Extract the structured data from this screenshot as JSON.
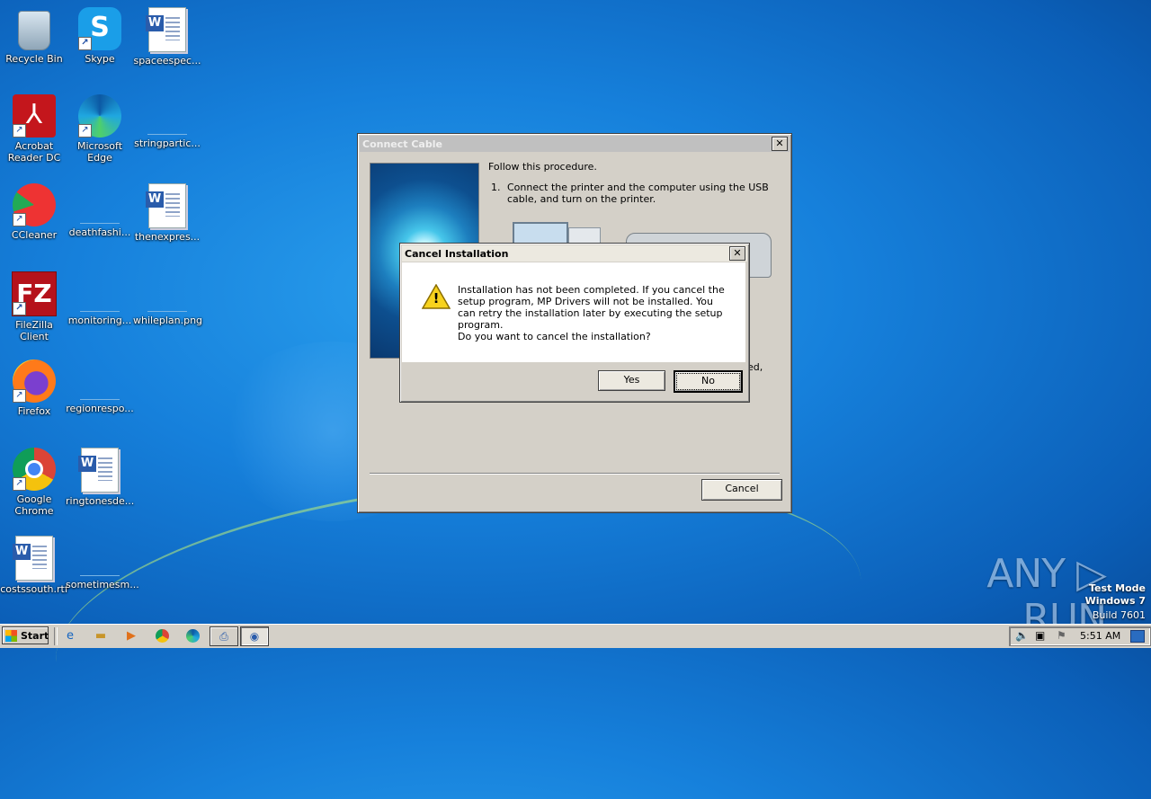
{
  "desktop": {
    "icons": [
      {
        "label": "Recycle Bin"
      },
      {
        "label": "Skype"
      },
      {
        "label": "spaceespec..."
      },
      {
        "label": "Acrobat Reader DC"
      },
      {
        "label": "Microsoft Edge"
      },
      {
        "label": "stringpartic..."
      },
      {
        "label": "CCleaner"
      },
      {
        "label": "deathfashi..."
      },
      {
        "label": "thenexpres..."
      },
      {
        "label": "FileZilla Client"
      },
      {
        "label": "monitoring..."
      },
      {
        "label": "whileplan.png"
      },
      {
        "label": "Firefox"
      },
      {
        "label": "regionrespo..."
      },
      {
        "label": "Google Chrome"
      },
      {
        "label": "ringtonesde..."
      },
      {
        "label": "costssouth.rtf"
      },
      {
        "label": "sometimesm..."
      }
    ]
  },
  "connect_cable": {
    "title": "Connect Cable",
    "close": "✕",
    "instruction": "Follow this procedure.",
    "step_number": "1.",
    "step_text": "Connect the printer and the computer using the USB cable, and turn on the printer.",
    "partial_text": "ed,",
    "cancel_label": "Cancel"
  },
  "cancel_dialog": {
    "title": "Cancel Installation",
    "close": "✕",
    "message": "Installation has not been completed. If you cancel the setup program, MP Drivers will not be installed. You can retry the installation later by executing the setup program.",
    "question": "Do you want to cancel the installation?",
    "yes_label": "Yes",
    "no_label": "No",
    "warning_glyph": "!"
  },
  "taskbar": {
    "start_label": "Start",
    "clock": "5:51 AM"
  },
  "watermark": {
    "brand": "ANY ▷ RUN",
    "mode": "Test Mode",
    "os": "Windows 7",
    "build": "Build 7601"
  },
  "colors": {
    "accent": "#1680db",
    "dialog_face": "#d4d0c8"
  }
}
